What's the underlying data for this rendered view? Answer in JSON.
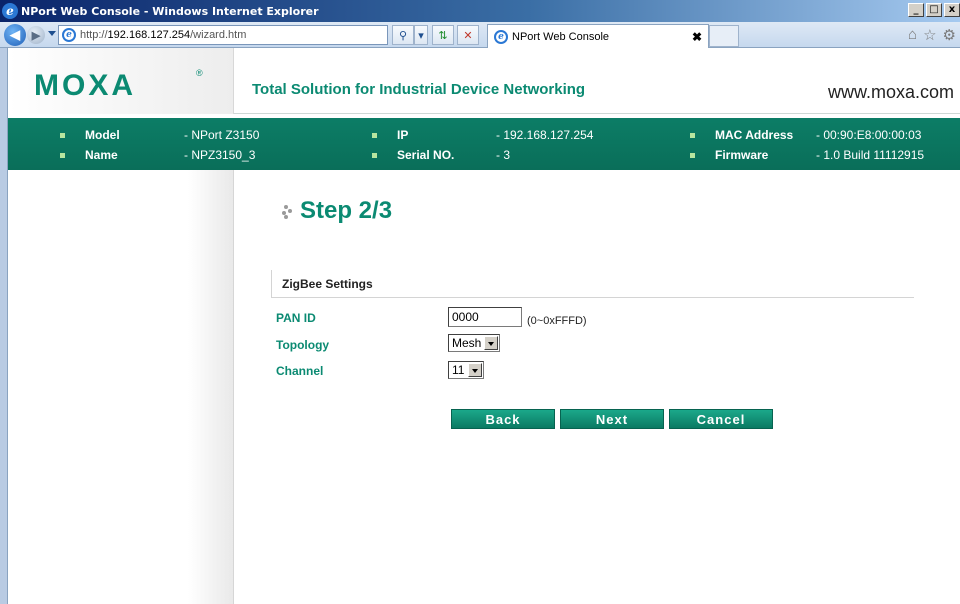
{
  "browser": {
    "window_title": "NPort Web Console - Windows Internet Explorer",
    "url_prefix": "http://",
    "url_host": "192.168.127.254",
    "url_path": "/wizard.htm",
    "tab_title": "NPort Web Console",
    "window_controls": [
      "_",
      "□",
      "x"
    ]
  },
  "header": {
    "logo": "MOXA",
    "logo_mark": "®",
    "tagline": "Total Solution for Industrial Device Networking",
    "website": "www.moxa.com"
  },
  "info": {
    "model_label": "Model",
    "model_value": "- NPort Z3150",
    "name_label": "Name",
    "name_value": "- NPZ3150_3",
    "ip_label": "IP",
    "ip_value": "- 192.168.127.254",
    "serial_label": "Serial NO.",
    "serial_value": "- 3",
    "mac_label": "MAC Address",
    "mac_value": "- 00:90:E8:00:00:03",
    "firmware_label": "Firmware",
    "firmware_value": "- 1.0 Build 11112915"
  },
  "main": {
    "step_title": "Step 2/3",
    "section_title": "ZigBee Settings",
    "pan_id_label": "PAN ID",
    "pan_id_value": "0000",
    "pan_id_hint": "(0~0xFFFD)",
    "topology_label": "Topology",
    "topology_value": "Mesh",
    "channel_label": "Channel",
    "channel_value": "11",
    "back_label": "Back",
    "next_label": "Next",
    "cancel_label": "Cancel"
  },
  "colors": {
    "brand_green": "#0b8a72",
    "infobar_green": "#0c7d66",
    "button_green": "#139a7e"
  }
}
